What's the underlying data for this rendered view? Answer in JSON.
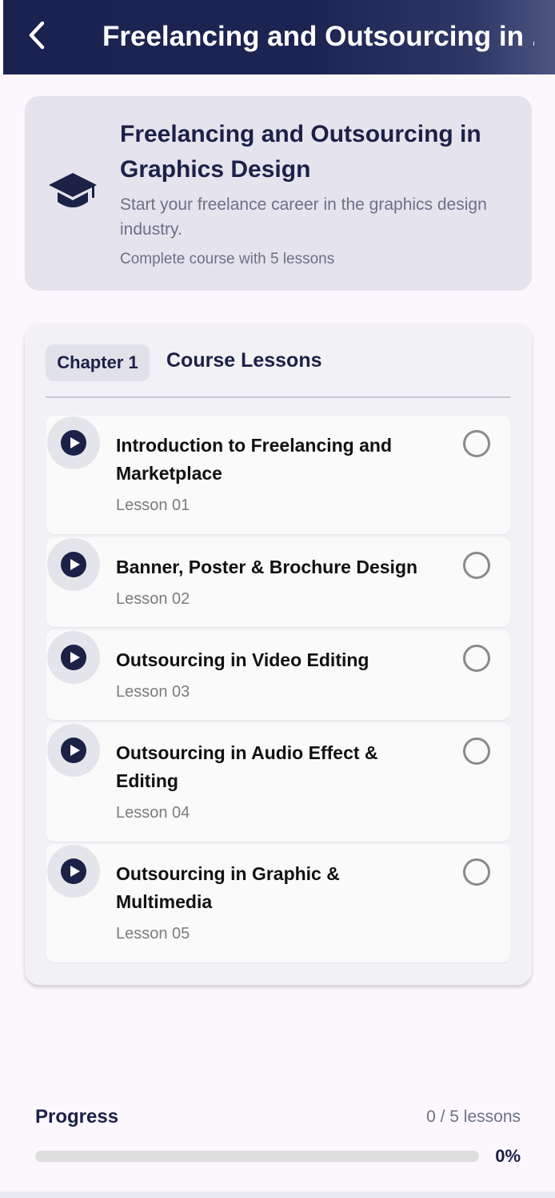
{
  "appbar": {
    "title": "Freelancing and Outsourcing in ..."
  },
  "course": {
    "icon": "graduation-cap-icon",
    "title": "Freelancing and Outsourcing in Graphics Design",
    "description": "Start your freelance career in the graphics design industry.",
    "meta": "Complete course with 5 lessons"
  },
  "lessons_section": {
    "chapter_label": "Chapter 1",
    "heading": "Course Lessons",
    "items": [
      {
        "title": "Introduction to Freelancing and Marketplace",
        "subtitle": "Lesson 01",
        "completed": false
      },
      {
        "title": "Banner, Poster & Brochure Design",
        "subtitle": "Lesson 02",
        "completed": false
      },
      {
        "title": "Outsourcing in Video Editing",
        "subtitle": "Lesson 03",
        "completed": false
      },
      {
        "title": "Outsourcing in Audio Effect & Editing",
        "subtitle": "Lesson 04",
        "completed": false
      },
      {
        "title": "Outsourcing in Graphic & Multimedia",
        "subtitle": "Lesson 05",
        "completed": false
      }
    ]
  },
  "progress": {
    "label": "Progress",
    "count_text": "0 / 5 lessons",
    "percent_text": "0%",
    "fraction": 0
  },
  "colors": {
    "primary": "#1b2147",
    "background": "#fbf7fd",
    "card": "#e5e3ec"
  }
}
